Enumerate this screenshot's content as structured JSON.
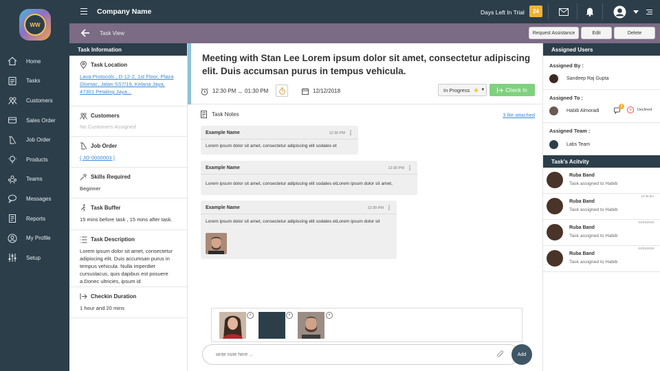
{
  "nav": {
    "items": [
      {
        "label": "Home",
        "icon": "home-icon"
      },
      {
        "label": "Tasks",
        "icon": "tasks-icon"
      },
      {
        "label": "Customers",
        "icon": "customers-icon"
      },
      {
        "label": "Sales Order",
        "icon": "sales-order-icon"
      },
      {
        "label": "Job Order",
        "icon": "job-order-icon"
      },
      {
        "label": "Products",
        "icon": "products-icon"
      },
      {
        "label": "Teams",
        "icon": "teams-icon"
      },
      {
        "label": "Messages",
        "icon": "messages-icon"
      },
      {
        "label": "Reports",
        "icon": "reports-icon"
      },
      {
        "label": "My Profile",
        "icon": "profile-icon"
      },
      {
        "label": "Setup",
        "icon": "setup-icon"
      }
    ]
  },
  "topbar": {
    "company": "Company Name",
    "trial_label": "Days Left In Trial",
    "trial_days": "24"
  },
  "subbar": {
    "title": "Task View",
    "request_assistance": "Request Assistance",
    "edit": "Edit",
    "delete": "Delete"
  },
  "info": {
    "header": "Task Information",
    "location_title": "Task Location",
    "location_value": "Lava Protocols , D-12-2, 1st Floor, Plaza Glomac, Jalan SS7/19,  Kelana Jaya, 47301 Petaling Jaya...",
    "customers_title": "Customers",
    "customers_value": "No Customers Assigned",
    "job_title": "Job Order",
    "job_value": "( JO-0000003 )",
    "skills_title": "Skills Required",
    "skills_value": "Beginner",
    "buffer_title": "Task Buffer",
    "buffer_value": "15 mins before task , 15 mins after task.",
    "desc_title": "Task Description",
    "desc_value": "Lorem ipsum dolor sit amet, consectetur adipiscing elit. Duis accumsan purus in tempus vehicula. Nulla imperdiet cursuslacus, quis dapibus est posuere a.Donec ultricies, ipsum id",
    "checkin_title": "Checkin Duration",
    "checkin_value": "1 hour and 20 mins"
  },
  "task": {
    "title": "Meeting with Stan Lee Lorem ipsum dolor sit amet, consectetur adipiscing elit. Duis accumsan purus in tempus vehicula.",
    "time_start": "12:30 PM",
    "time_sep": "_",
    "time_end": "01:30 PM",
    "date": "12/12/2018",
    "status": "In Progress",
    "checkin": "Check In",
    "notes_label": "Task Notes",
    "files_link": "3 file attached",
    "notes": [
      {
        "name": "Example Name",
        "time": "12:30 PM",
        "text": "Lorem ipsum dolor sit amet, consectetur adipiscing elit sodales et"
      },
      {
        "name": "Example Name",
        "time": "12:30 PM",
        "text": "Lorem ipsum dolor sit amet, consectetur adipiscing elit sodales etLorem ipsum dolor sit amet,"
      },
      {
        "name": "Example Name",
        "time": "12:30 PM",
        "text": "Lorem ipsum dolor sit amet, consectetur adipiscing elit sodales etLorem ipsum dolor sit"
      }
    ],
    "input_placeholder": "write note here ...",
    "add": "Add"
  },
  "right": {
    "assigned_header": "Assigned Users",
    "assigned_by_label": "Assigned By :",
    "assigned_by": "Sandeep Raj Gupta",
    "assigned_to_label": "Assigned To :",
    "assigned_to": "Habib Almoradi",
    "assigned_to_badge": "3",
    "assigned_to_status": "Declined",
    "team_label": "Assigned Team :",
    "team": "Labs Team",
    "activity_header": "Task's Acitvity",
    "activities": [
      {
        "name": "Ruba Band",
        "text": "Task assigned to Habib",
        "time": ""
      },
      {
        "name": "Ruba Band",
        "text": "Task assigned to Habib",
        "time": "12:30 pm"
      },
      {
        "name": "Ruba Band",
        "text": "Task assigned to Habib",
        "time": "01/04/2018"
      },
      {
        "name": "Ruba Band",
        "text": "Task assigned to Habib",
        "time": "01/04/2018"
      }
    ]
  },
  "colors": {
    "sidebar": "#2c3e4a",
    "subbar": "#7b6b85",
    "trial_badge": "#f2b233",
    "checkin": "#7fd17f",
    "link": "#3a8ad6",
    "declined": "#e05050"
  }
}
